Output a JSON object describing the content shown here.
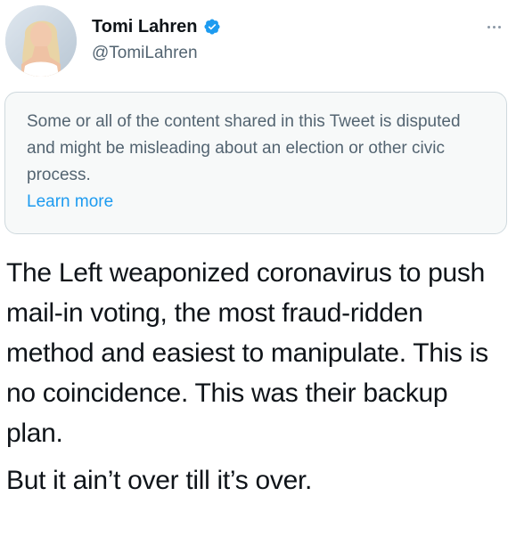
{
  "author": {
    "display_name": "Tomi Lahren",
    "handle": "@TomiLahren",
    "verified": true,
    "avatar_icon": "profile-photo"
  },
  "notice": {
    "text": "Some or all of the content shared in this Tweet is disputed and might be misleading about an election or other civic process.",
    "link_label": "Learn more",
    "link_color": "#1d9bf0"
  },
  "tweet": {
    "paragraphs": [
      "The Left weaponized coronavirus to push mail-in voting, the most fraud-ridden method and easiest to manipulate. This is no coincidence. This was their backup plan.",
      "But it ain’t over till it’s over."
    ]
  },
  "icons": {
    "verified": "verified-badge-icon",
    "more": "more-options-icon"
  },
  "colors": {
    "text": "#0f1419",
    "secondary": "#536471",
    "accent": "#1d9bf0"
  }
}
